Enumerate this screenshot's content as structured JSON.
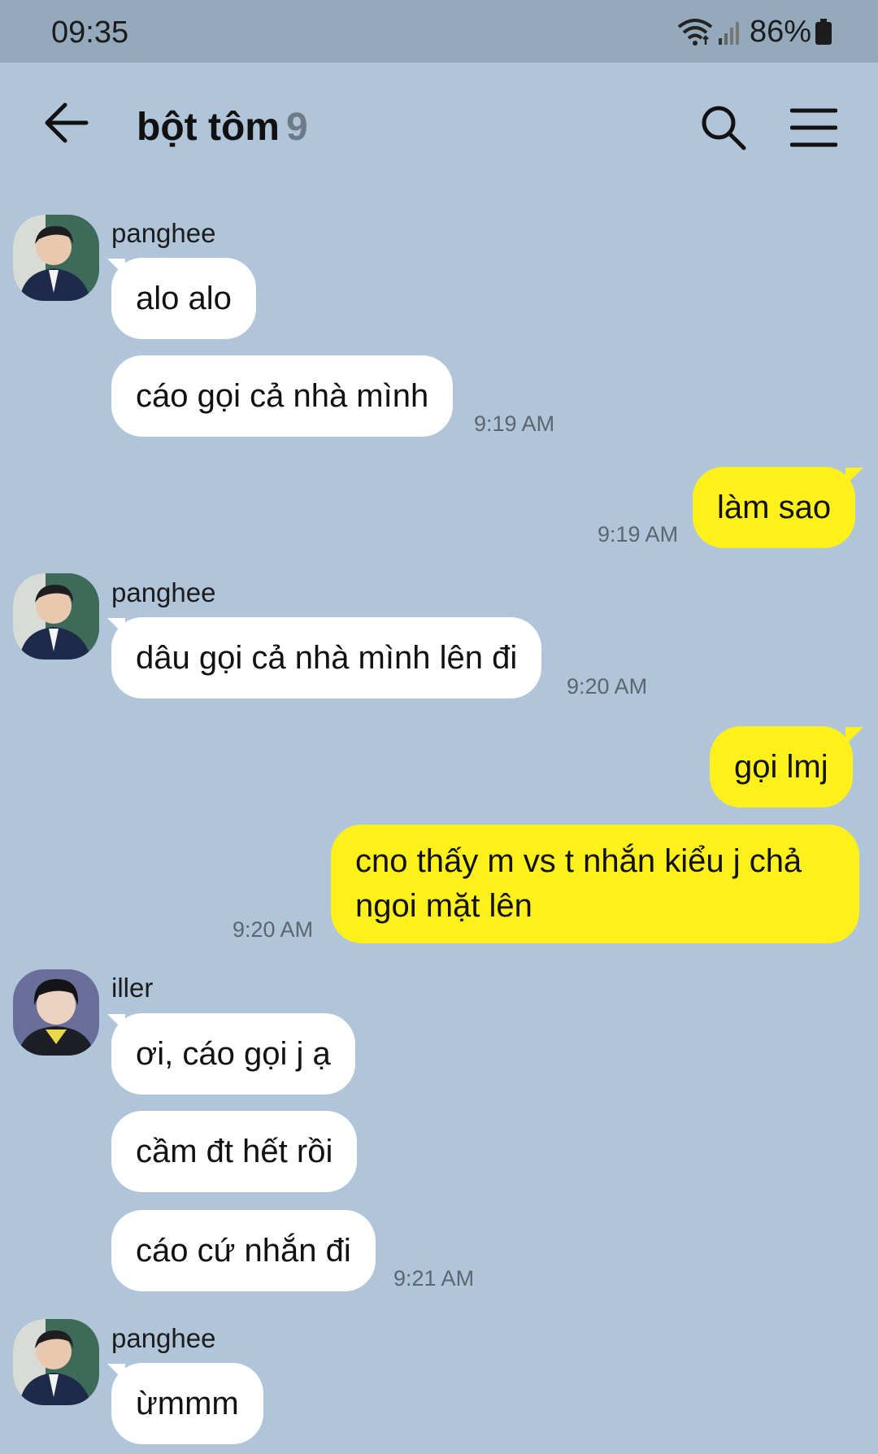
{
  "status_bar": {
    "time": "09:35",
    "battery": "86%"
  },
  "header": {
    "title": "bột tôm",
    "member_count": "9"
  },
  "senders": {
    "panghee": "panghee",
    "iller": "iller"
  },
  "messages": [
    {
      "from": "panghee",
      "text": "alo alo"
    },
    {
      "from": "panghee",
      "text": "cáo gọi cả nhà mình",
      "time": "9:19 AM"
    },
    {
      "from": "me",
      "text": "làm sao",
      "time": "9:19 AM"
    },
    {
      "from": "panghee",
      "text": "dâu gọi cả nhà mình lên đi",
      "time": "9:20 AM"
    },
    {
      "from": "me",
      "text": "gọi lmj"
    },
    {
      "from": "me",
      "text": "cno thấy m vs t nhắn kiểu j chả ngoi mặt lên",
      "time": "9:20 AM"
    },
    {
      "from": "iller",
      "text": "ơi, cáo gọi j ạ"
    },
    {
      "from": "iller",
      "text": "cầm đt hết rồi"
    },
    {
      "from": "iller",
      "text": "cáo cứ nhắn đi",
      "time": "9:21 AM"
    },
    {
      "from": "panghee",
      "text": "ừmmm"
    }
  ],
  "colors": {
    "background": "#b0c5d9",
    "incoming_bubble": "#ffffff",
    "outgoing_bubble": "#fef01b",
    "status_bar": "#95a9bc"
  }
}
